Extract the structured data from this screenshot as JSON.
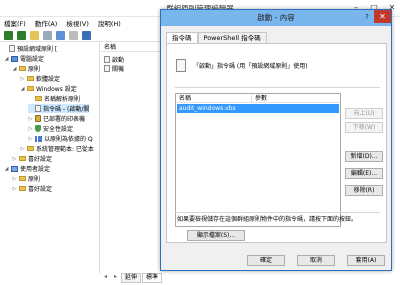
{
  "main_window": {
    "title": "群組原則管理編輯器",
    "menu": [
      "檔案(F)",
      "動作(A)",
      "檢視(V)",
      "說明(H)"
    ],
    "tree": [
      {
        "label": "預設網域原則 [",
        "indent": 0,
        "icon": "policy-icon"
      },
      {
        "label": "電腦設定",
        "indent": 1,
        "icon": "computer-icon"
      },
      {
        "label": "原則",
        "indent": 2,
        "icon": "folder-icon"
      },
      {
        "label": "軟體設定",
        "indent": 3,
        "icon": "folder-icon"
      },
      {
        "label": "Windows 設定",
        "indent": 3,
        "icon": "folder-icon"
      },
      {
        "label": "名稱解析原則",
        "indent": 4,
        "icon": "folder-icon"
      },
      {
        "label": "指令碼 - (啟動/關",
        "indent": 4,
        "icon": "script-icon"
      },
      {
        "label": "已部署的印表機",
        "indent": 4,
        "icon": "printer-icon"
      },
      {
        "label": "安全性設定",
        "indent": 4,
        "icon": "shield-icon"
      },
      {
        "label": "以原則為依據的 Q",
        "indent": 4,
        "icon": "chart-icon"
      },
      {
        "label": "系統管理範本: 已從本",
        "indent": 3,
        "icon": "folder-icon"
      },
      {
        "label": "喜好設定",
        "indent": 2,
        "icon": "folder-icon"
      },
      {
        "label": "使用者設定",
        "indent": 1,
        "icon": "user-icon"
      },
      {
        "label": "原則",
        "indent": 2,
        "icon": "folder-icon"
      },
      {
        "label": "喜好設定",
        "indent": 2,
        "icon": "folder-icon"
      }
    ],
    "name_header": "名稱",
    "names": [
      "啟動",
      "關機"
    ],
    "tabs": [
      "延伸",
      "標準"
    ]
  },
  "dialog": {
    "title": "啟動 - 內容",
    "help": "?",
    "close": "✕",
    "tabs": [
      "指令碼",
      "PowerShell 指令碼"
    ],
    "intro": "「啟動」指令碼 (用「預設網域原則」使用)",
    "list_header": {
      "name": "名稱",
      "param": "參數"
    },
    "list_rows": [
      "audit_windows.vbs"
    ],
    "side_buttons": {
      "up": "向上(U)",
      "down": "下移(W)",
      "add": "新增(D)...",
      "edit": "編輯(E)...",
      "remove": "移除(R)"
    },
    "footer_text": "如果要檢視儲存在這個群組原則物件中的指令碼，請按下面的按鈕。",
    "show_files": "顯示檔案(S)...",
    "ok": "確定",
    "cancel": "取消",
    "apply": "套用(A)"
  },
  "colors": {
    "dialog_title_bg": "#79b6ee",
    "selected_row": "#3399ff",
    "close_button": "#c0392b"
  }
}
